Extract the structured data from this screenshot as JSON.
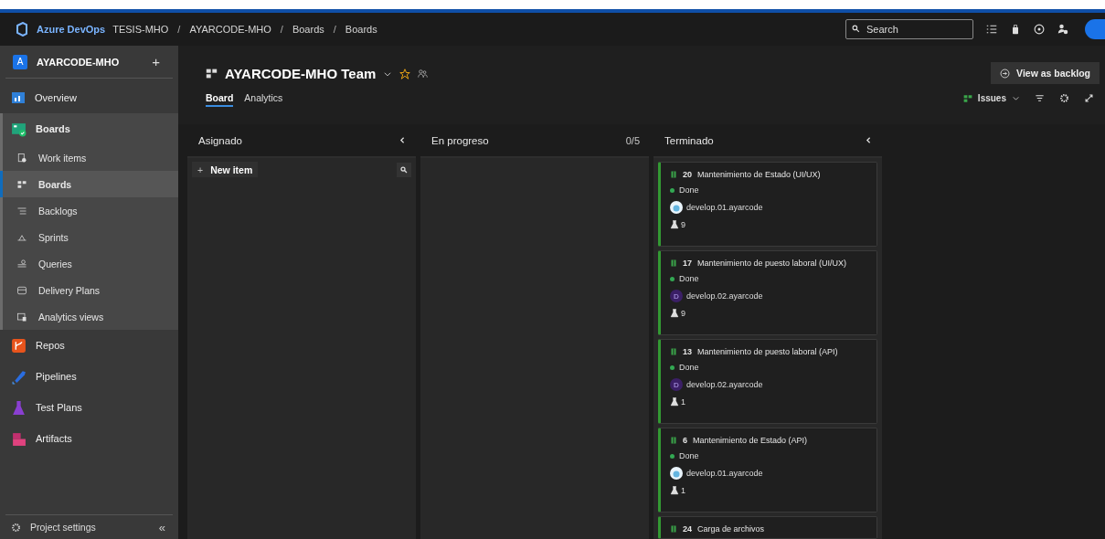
{
  "header": {
    "product": "Azure DevOps",
    "breadcrumbs": [
      {
        "label": "TESIS-MHO"
      },
      {
        "separator": "/",
        "label": "AYARCODE-MHO"
      },
      {
        "separator": "/",
        "label": "Boards"
      },
      {
        "separator": "/",
        "label": "Boards"
      }
    ],
    "search": {
      "placeholder": "Search"
    }
  },
  "sidebar": {
    "project": {
      "initial": "A",
      "name": "AYARCODE-MHO",
      "add": "+"
    },
    "items": [
      {
        "label": "Overview",
        "expanded": false
      },
      {
        "label": "Boards",
        "expanded": true,
        "children": [
          {
            "label": "Work items",
            "selected": false
          },
          {
            "label": "Boards",
            "selected": true
          },
          {
            "label": "Backlogs",
            "selected": false
          },
          {
            "label": "Sprints",
            "selected": false
          },
          {
            "label": "Queries",
            "selected": false
          },
          {
            "label": "Delivery Plans",
            "selected": false
          },
          {
            "label": "Analytics views",
            "selected": false
          }
        ]
      },
      {
        "label": "Repos",
        "expanded": false
      },
      {
        "label": "Pipelines",
        "expanded": false
      },
      {
        "label": "Test Plans",
        "expanded": false
      },
      {
        "label": "Artifacts",
        "expanded": false
      }
    ],
    "settings": "Project settings",
    "collapse": "«"
  },
  "team": {
    "title": "AYARCODE-MHO Team",
    "tabs": [
      {
        "label": "Board",
        "selected": true
      },
      {
        "label": "Analytics",
        "selected": false
      }
    ],
    "view_button": "View as backlog",
    "work_item_type": "Issues"
  },
  "columns": [
    {
      "title": "Asignado",
      "collapsible": true,
      "new_item": {
        "icon": "+",
        "label": "New item"
      }
    },
    {
      "title": "En progreso",
      "collapsible": false,
      "count": "0/5"
    },
    {
      "title": "Terminado",
      "collapsible": true,
      "cards": [
        {
          "id": "20",
          "title": "Mantenimiento de Estado (UI/UX)",
          "state": "Done",
          "assignee": {
            "name": "develop.01.ayarcode",
            "kind": "picture"
          },
          "tests": "9"
        },
        {
          "id": "17",
          "title": "Mantenimiento de puesto laboral (UI/UX)",
          "state": "Done",
          "assignee": {
            "name": "develop.02.ayarcode",
            "kind": "initial",
            "initial": "D"
          },
          "tests": "9"
        },
        {
          "id": "13",
          "title": "Mantenimiento de puesto laboral (API)",
          "state": "Done",
          "assignee": {
            "name": "develop.02.ayarcode",
            "kind": "initial",
            "initial": "D"
          },
          "tests": "1"
        },
        {
          "id": "6",
          "title": "Mantenimiento de Estado (API)",
          "state": "Done",
          "assignee": {
            "name": "develop.01.ayarcode",
            "kind": "picture"
          },
          "tests": "1"
        },
        {
          "id": "24",
          "title": "Carga de archivos"
        }
      ]
    }
  ]
}
